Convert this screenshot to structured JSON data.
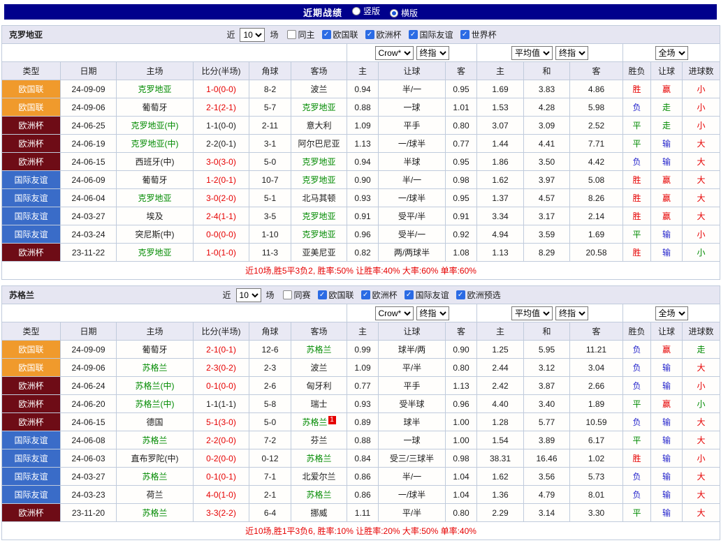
{
  "topbar": {
    "title": "近期战绩",
    "radios": [
      {
        "label": "竖版",
        "selected": false
      },
      {
        "label": "横版",
        "selected": true
      }
    ]
  },
  "type_colors": {
    "欧国联": "#f09a2c",
    "欧洲杯": "#6e0c16",
    "国际友谊": "#3a6cc8"
  },
  "sections": [
    {
      "team": "克罗地亚",
      "filter": {
        "near_label": "近",
        "count": "10",
        "games_label": "场",
        "same_label": "同主",
        "leagues": [
          "欧国联",
          "欧洲杯",
          "国际友谊",
          "世界杯"
        ]
      },
      "selects": {
        "odds_src": "Crow*",
        "odds_mode": "终指",
        "avg_src": "平均值",
        "avg_mode": "终指",
        "scope": "全场"
      },
      "columns": [
        "类型",
        "日期",
        "主场",
        "比分(半场)",
        "角球",
        "客场",
        "主",
        "让球",
        "客",
        "主",
        "和",
        "客",
        "胜负",
        "让球",
        "进球数"
      ],
      "rows": [
        {
          "type": "欧国联",
          "date": "24-09-09",
          "home": "克罗地亚",
          "home_green": true,
          "score": "1-0(0-0)",
          "score_red": true,
          "corner": "8-2",
          "away": "波兰",
          "away_green": false,
          "o1": "0.94",
          "handicap": "半/一",
          "o2": "0.95",
          "m1": "1.69",
          "m2": "3.83",
          "m3": "4.86",
          "wl": "胜",
          "wl_c": "red",
          "hc": "赢",
          "hc_c": "red",
          "gl": "小",
          "gl_c": "red"
        },
        {
          "type": "欧国联",
          "date": "24-09-06",
          "home": "葡萄牙",
          "home_green": false,
          "score": "2-1(2-1)",
          "score_red": true,
          "corner": "5-7",
          "away": "克罗地亚",
          "away_green": true,
          "o1": "0.88",
          "handicap": "一球",
          "o2": "1.01",
          "m1": "1.53",
          "m2": "4.28",
          "m3": "5.98",
          "wl": "负",
          "wl_c": "blue",
          "hc": "走",
          "hc_c": "green",
          "gl": "小",
          "gl_c": "red"
        },
        {
          "type": "欧洲杯",
          "date": "24-06-25",
          "home": "克罗地亚(中)",
          "home_green": true,
          "score": "1-1(0-0)",
          "score_red": false,
          "corner": "2-11",
          "away": "意大利",
          "away_green": false,
          "o1": "1.09",
          "handicap": "平手",
          "o2": "0.80",
          "m1": "3.07",
          "m2": "3.09",
          "m3": "2.52",
          "wl": "平",
          "wl_c": "green",
          "hc": "走",
          "hc_c": "green",
          "gl": "小",
          "gl_c": "red"
        },
        {
          "type": "欧洲杯",
          "date": "24-06-19",
          "home": "克罗地亚(中)",
          "home_green": true,
          "score": "2-2(0-1)",
          "score_red": false,
          "corner": "3-1",
          "away": "阿尔巴尼亚",
          "away_green": false,
          "o1": "1.13",
          "handicap": "一/球半",
          "o2": "0.77",
          "m1": "1.44",
          "m2": "4.41",
          "m3": "7.71",
          "wl": "平",
          "wl_c": "green",
          "hc": "输",
          "hc_c": "blue",
          "gl": "大",
          "gl_c": "red"
        },
        {
          "type": "欧洲杯",
          "date": "24-06-15",
          "home": "西班牙(中)",
          "home_green": false,
          "score": "3-0(3-0)",
          "score_red": true,
          "corner": "5-0",
          "away": "克罗地亚",
          "away_green": true,
          "o1": "0.94",
          "handicap": "半球",
          "o2": "0.95",
          "m1": "1.86",
          "m2": "3.50",
          "m3": "4.42",
          "wl": "负",
          "wl_c": "blue",
          "hc": "输",
          "hc_c": "blue",
          "gl": "大",
          "gl_c": "red"
        },
        {
          "type": "国际友谊",
          "date": "24-06-09",
          "home": "葡萄牙",
          "home_green": false,
          "score": "1-2(0-1)",
          "score_red": true,
          "corner": "10-7",
          "away": "克罗地亚",
          "away_green": true,
          "o1": "0.90",
          "handicap": "半/一",
          "o2": "0.98",
          "m1": "1.62",
          "m2": "3.97",
          "m3": "5.08",
          "wl": "胜",
          "wl_c": "red",
          "hc": "赢",
          "hc_c": "red",
          "gl": "大",
          "gl_c": "red"
        },
        {
          "type": "国际友谊",
          "date": "24-06-04",
          "home": "克罗地亚",
          "home_green": true,
          "score": "3-0(2-0)",
          "score_red": true,
          "corner": "5-1",
          "away": "北马其顿",
          "away_green": false,
          "o1": "0.93",
          "handicap": "一/球半",
          "o2": "0.95",
          "m1": "1.37",
          "m2": "4.57",
          "m3": "8.26",
          "wl": "胜",
          "wl_c": "red",
          "hc": "赢",
          "hc_c": "red",
          "gl": "大",
          "gl_c": "red"
        },
        {
          "type": "国际友谊",
          "date": "24-03-27",
          "home": "埃及",
          "home_green": false,
          "score": "2-4(1-1)",
          "score_red": true,
          "corner": "3-5",
          "away": "克罗地亚",
          "away_green": true,
          "o1": "0.91",
          "handicap": "受平/半",
          "o2": "0.91",
          "m1": "3.34",
          "m2": "3.17",
          "m3": "2.14",
          "wl": "胜",
          "wl_c": "red",
          "hc": "赢",
          "hc_c": "red",
          "gl": "大",
          "gl_c": "red"
        },
        {
          "type": "国际友谊",
          "date": "24-03-24",
          "home": "突尼斯(中)",
          "home_green": false,
          "score": "0-0(0-0)",
          "score_red": true,
          "corner": "1-10",
          "away": "克罗地亚",
          "away_green": true,
          "o1": "0.96",
          "handicap": "受半/一",
          "o2": "0.92",
          "m1": "4.94",
          "m2": "3.59",
          "m3": "1.69",
          "wl": "平",
          "wl_c": "green",
          "hc": "输",
          "hc_c": "blue",
          "gl": "小",
          "gl_c": "red"
        },
        {
          "type": "欧洲杯",
          "date": "23-11-22",
          "home": "克罗地亚",
          "home_green": true,
          "score": "1-0(1-0)",
          "score_red": true,
          "corner": "11-3",
          "away": "亚美尼亚",
          "away_green": false,
          "o1": "0.82",
          "handicap": "两/两球半",
          "o2": "1.08",
          "m1": "1.13",
          "m2": "8.29",
          "m3": "20.58",
          "wl": "胜",
          "wl_c": "red",
          "hc": "输",
          "hc_c": "blue",
          "gl": "小",
          "gl_c": "green"
        }
      ],
      "summary": "近10场,胜5平3负2, 胜率:50% 让胜率:40% 大率:60% 单率:60%"
    },
    {
      "team": "苏格兰",
      "filter": {
        "near_label": "近",
        "count": "10",
        "games_label": "场",
        "same_label": "同赛",
        "leagues": [
          "欧国联",
          "欧洲杯",
          "国际友谊",
          "欧洲预选"
        ]
      },
      "selects": {
        "odds_src": "Crow*",
        "odds_mode": "终指",
        "avg_src": "平均值",
        "avg_mode": "终指",
        "scope": "全场"
      },
      "columns": [
        "类型",
        "日期",
        "主场",
        "比分(半场)",
        "角球",
        "客场",
        "主",
        "让球",
        "客",
        "主",
        "和",
        "客",
        "胜负",
        "让球",
        "进球数"
      ],
      "rows": [
        {
          "type": "欧国联",
          "date": "24-09-09",
          "home": "葡萄牙",
          "home_green": false,
          "score": "2-1(0-1)",
          "score_red": true,
          "corner": "12-6",
          "away": "苏格兰",
          "away_green": true,
          "o1": "0.99",
          "handicap": "球半/两",
          "o2": "0.90",
          "m1": "1.25",
          "m2": "5.95",
          "m3": "11.21",
          "wl": "负",
          "wl_c": "blue",
          "hc": "赢",
          "hc_c": "red",
          "gl": "走",
          "gl_c": "green"
        },
        {
          "type": "欧国联",
          "date": "24-09-06",
          "home": "苏格兰",
          "home_green": true,
          "score": "2-3(0-2)",
          "score_red": true,
          "corner": "2-3",
          "away": "波兰",
          "away_green": false,
          "o1": "1.09",
          "handicap": "平/半",
          "o2": "0.80",
          "m1": "2.44",
          "m2": "3.12",
          "m3": "3.04",
          "wl": "负",
          "wl_c": "blue",
          "hc": "输",
          "hc_c": "blue",
          "gl": "大",
          "gl_c": "red"
        },
        {
          "type": "欧洲杯",
          "date": "24-06-24",
          "home": "苏格兰(中)",
          "home_green": true,
          "score": "0-1(0-0)",
          "score_red": true,
          "corner": "2-6",
          "away": "匈牙利",
          "away_green": false,
          "o1": "0.77",
          "handicap": "平手",
          "o2": "1.13",
          "m1": "2.42",
          "m2": "3.87",
          "m3": "2.66",
          "wl": "负",
          "wl_c": "blue",
          "hc": "输",
          "hc_c": "blue",
          "gl": "小",
          "gl_c": "red"
        },
        {
          "type": "欧洲杯",
          "date": "24-06-20",
          "home": "苏格兰(中)",
          "home_green": true,
          "score": "1-1(1-1)",
          "score_red": false,
          "corner": "5-8",
          "away": "瑞士",
          "away_green": false,
          "o1": "0.93",
          "handicap": "受半球",
          "o2": "0.96",
          "m1": "4.40",
          "m2": "3.40",
          "m3": "1.89",
          "wl": "平",
          "wl_c": "green",
          "hc": "赢",
          "hc_c": "red",
          "gl": "小",
          "gl_c": "green"
        },
        {
          "type": "欧洲杯",
          "date": "24-06-15",
          "home": "德国",
          "home_green": false,
          "score": "5-1(3-0)",
          "score_red": true,
          "corner": "5-0",
          "away": "苏格兰",
          "away_green": true,
          "away_badge": "1",
          "o1": "0.89",
          "handicap": "球半",
          "o2": "1.00",
          "m1": "1.28",
          "m2": "5.77",
          "m3": "10.59",
          "wl": "负",
          "wl_c": "blue",
          "hc": "输",
          "hc_c": "blue",
          "gl": "大",
          "gl_c": "red"
        },
        {
          "type": "国际友谊",
          "date": "24-06-08",
          "home": "苏格兰",
          "home_green": true,
          "score": "2-2(0-0)",
          "score_red": true,
          "corner": "7-2",
          "away": "芬兰",
          "away_green": false,
          "o1": "0.88",
          "handicap": "一球",
          "o2": "1.00",
          "m1": "1.54",
          "m2": "3.89",
          "m3": "6.17",
          "wl": "平",
          "wl_c": "green",
          "hc": "输",
          "hc_c": "blue",
          "gl": "大",
          "gl_c": "red"
        },
        {
          "type": "国际友谊",
          "date": "24-06-03",
          "home": "直布罗陀(中)",
          "home_green": false,
          "score": "0-2(0-0)",
          "score_red": true,
          "corner": "0-12",
          "away": "苏格兰",
          "away_green": true,
          "o1": "0.84",
          "handicap": "受三/三球半",
          "o2": "0.98",
          "m1": "38.31",
          "m2": "16.46",
          "m3": "1.02",
          "wl": "胜",
          "wl_c": "red",
          "hc": "输",
          "hc_c": "blue",
          "gl": "小",
          "gl_c": "red"
        },
        {
          "type": "国际友谊",
          "date": "24-03-27",
          "home": "苏格兰",
          "home_green": true,
          "score": "0-1(0-1)",
          "score_red": true,
          "corner": "7-1",
          "away": "北爱尔兰",
          "away_green": false,
          "o1": "0.86",
          "handicap": "半/一",
          "o2": "1.04",
          "m1": "1.62",
          "m2": "3.56",
          "m3": "5.73",
          "wl": "负",
          "wl_c": "blue",
          "hc": "输",
          "hc_c": "blue",
          "gl": "大",
          "gl_c": "red"
        },
        {
          "type": "国际友谊",
          "date": "24-03-23",
          "home": "荷兰",
          "home_green": false,
          "score": "4-0(1-0)",
          "score_red": true,
          "corner": "2-1",
          "away": "苏格兰",
          "away_green": true,
          "o1": "0.86",
          "handicap": "一/球半",
          "o2": "1.04",
          "m1": "1.36",
          "m2": "4.79",
          "m3": "8.01",
          "wl": "负",
          "wl_c": "blue",
          "hc": "输",
          "hc_c": "blue",
          "gl": "大",
          "gl_c": "red"
        },
        {
          "type": "欧洲杯",
          "date": "23-11-20",
          "home": "苏格兰",
          "home_green": true,
          "score": "3-3(2-2)",
          "score_red": true,
          "corner": "6-4",
          "away": "挪威",
          "away_green": false,
          "o1": "1.11",
          "handicap": "平/半",
          "o2": "0.80",
          "m1": "2.29",
          "m2": "3.14",
          "m3": "3.30",
          "wl": "平",
          "wl_c": "green",
          "hc": "输",
          "hc_c": "blue",
          "gl": "大",
          "gl_c": "red"
        }
      ],
      "summary": "近10场,胜1平3负6, 胜率:10% 让胜率:20% 大率:50% 单率:40%"
    }
  ]
}
